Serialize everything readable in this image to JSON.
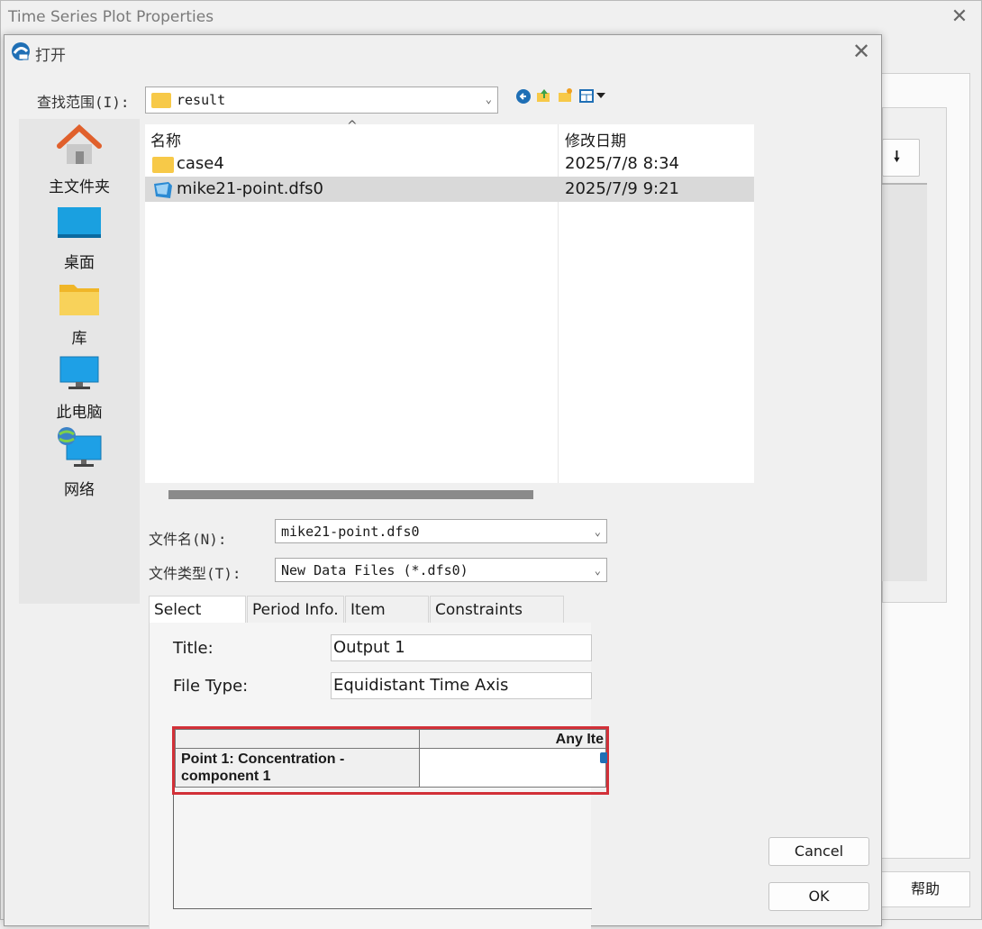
{
  "outer": {
    "title": "Time Series Plot Properties",
    "close": "✕",
    "help_label": "帮助",
    "drop_arrow": "🠗"
  },
  "dialog": {
    "title": "打开",
    "close": "✕",
    "lookin_label": "查找范围(I):",
    "lookin_value": "result",
    "toolbar_icons": [
      "back-icon",
      "up-folder-icon",
      "new-folder-icon",
      "view-menu-icon"
    ],
    "places": [
      {
        "label": "主文件夹",
        "icon": "home-icon"
      },
      {
        "label": "桌面",
        "icon": "desktop-icon"
      },
      {
        "label": "库",
        "icon": "library-icon"
      },
      {
        "label": "此电脑",
        "icon": "computer-icon"
      },
      {
        "label": "网络",
        "icon": "network-icon"
      }
    ],
    "columns": {
      "name": "名称",
      "modified": "修改日期"
    },
    "sort_indicator": "^",
    "files": [
      {
        "name": "case4",
        "modified": "2025/7/8 8:34",
        "icon": "folder-icon"
      },
      {
        "name": "mike21-point.dfs0",
        "modified": "2025/7/9 9:21",
        "icon": "mike-file-icon",
        "selected": true
      }
    ],
    "filename_label": "文件名(N):",
    "filename_value": "mike21-point.dfs0",
    "filetype_label": "文件类型(T):",
    "filetype_value": "New Data Files (*.dfs0)",
    "tabs": [
      "Select Item",
      "Period Info.",
      "Item Info.",
      "Constraints Info."
    ],
    "active_tab": "Select Item",
    "title_label": "Title:",
    "title_value": "Output 1",
    "filetype_field_label": "File Type:",
    "filetype_field_value": "Equidistant Time Axis",
    "grid": {
      "header": "Any Ite",
      "row_label": "Point 1: Concentration - component 1"
    },
    "cancel_label": "Cancel",
    "ok_label": "OK"
  }
}
